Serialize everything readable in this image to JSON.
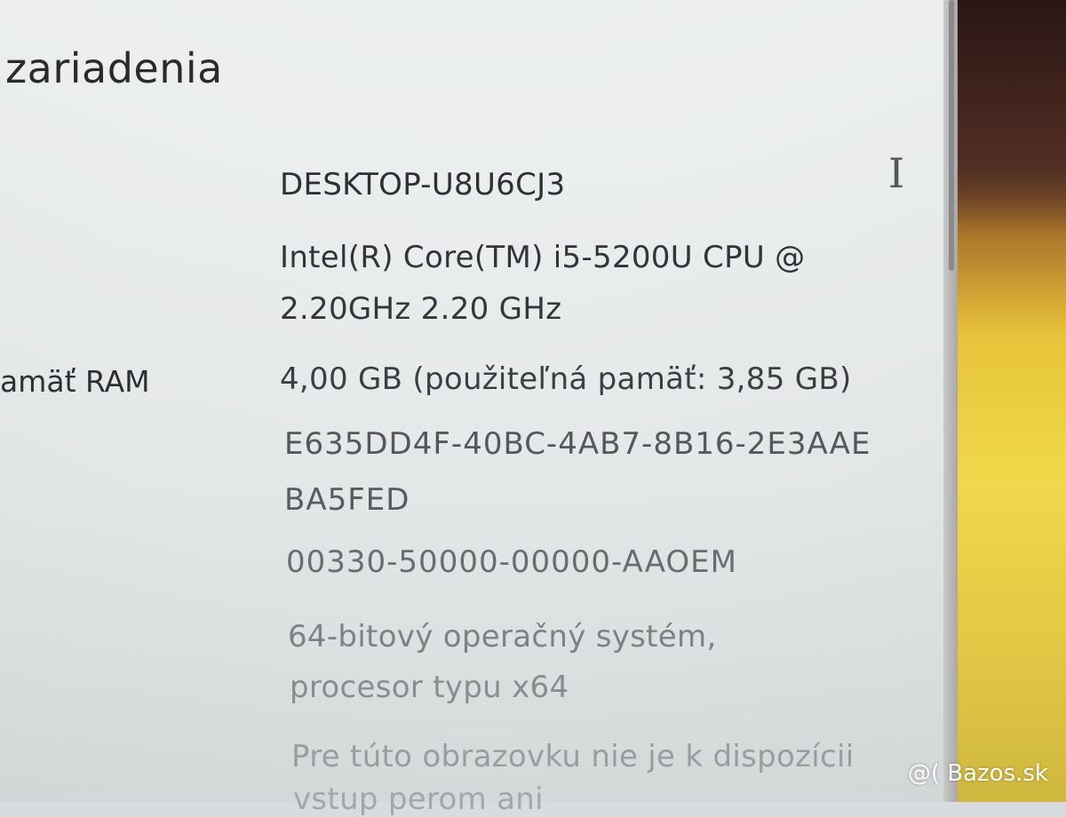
{
  "section": {
    "title": "zariadenia"
  },
  "specs": {
    "device_name": "DESKTOP-U8U6CJ3",
    "processor_line1": "Intel(R) Core(TM) i5-5200U CPU @",
    "processor_line2": "2.20GHz   2.20 GHz",
    "ram_label": "amäť RAM",
    "ram_value": "4,00 GB (použiteľná pamäť: 3,85 GB)",
    "device_id_line1": "E635DD4F-40BC-4AB7-8B16-2E3AAE",
    "device_id_line2": "BA5FED",
    "product_id": "00330-50000-00000-AAOEM",
    "system_type_line1": "64-bitový operačný systém,",
    "system_type_line2": "procesor typu x64",
    "pen_touch_line1": "Pre túto obrazovku nie je k dispozícii",
    "pen_touch_line2": "vstup perom ani"
  },
  "cursor": {
    "icon": "text-cursor-ibeam-icon",
    "glyph": "I"
  },
  "watermark": {
    "text": "@( Bazos.sk"
  }
}
